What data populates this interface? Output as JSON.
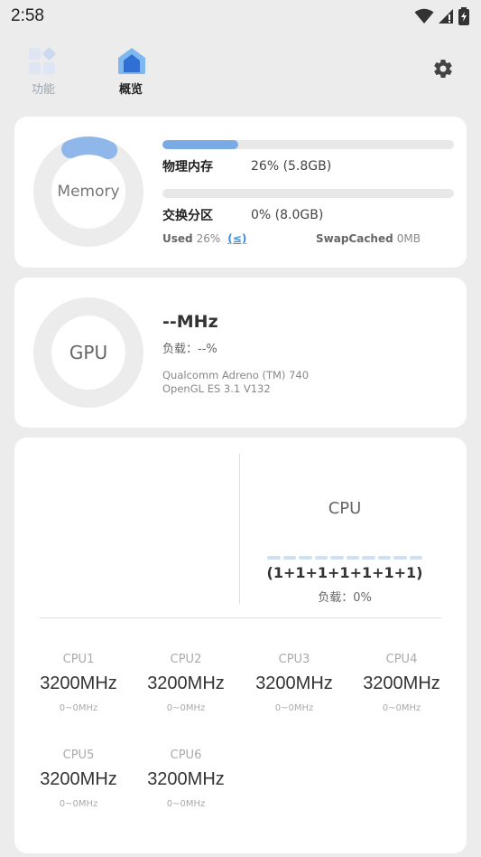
{
  "status_bar": {
    "time": "2:58"
  },
  "tabs": [
    {
      "label": "功能"
    },
    {
      "label": "概览"
    }
  ],
  "memory": {
    "ring_label": "Memory",
    "physical": {
      "name": "物理内存",
      "value": "26% (5.8GB)",
      "fraction": 0.26
    },
    "swap": {
      "name": "交换分区",
      "value": "0% (8.0GB)",
      "fraction": 0.0
    },
    "used_label": "Used",
    "used_value": "26%",
    "used_link": "(≤)",
    "swapcached_label": "SwapCached",
    "swapcached_value": "0MB"
  },
  "gpu": {
    "ring_label": "GPU",
    "freq": "--MHz",
    "load": "负载：--%",
    "model": "Qualcomm Adreno (TM) 740",
    "api": "OpenGL ES 3.1 V132"
  },
  "cpu": {
    "title": "CPU",
    "cores_text": "(1+1+1+1+1+1+1)",
    "load": "负载：0%",
    "cores": [
      {
        "name": "CPU1",
        "freq": "3200MHz",
        "range": "0~0MHz"
      },
      {
        "name": "CPU2",
        "freq": "3200MHz",
        "range": "0~0MHz"
      },
      {
        "name": "CPU3",
        "freq": "3200MHz",
        "range": "0~0MHz"
      },
      {
        "name": "CPU4",
        "freq": "3200MHz",
        "range": "0~0MHz"
      },
      {
        "name": "CPU5",
        "freq": "3200MHz",
        "range": "0~0MHz"
      },
      {
        "name": "CPU6",
        "freq": "3200MHz",
        "range": "0~0MHz"
      }
    ]
  },
  "colors": {
    "accent": "#3d8be0",
    "ring_track": "#ececec",
    "ring_fill": "#8fb7ea",
    "bar_fill": "#7aaae3"
  }
}
